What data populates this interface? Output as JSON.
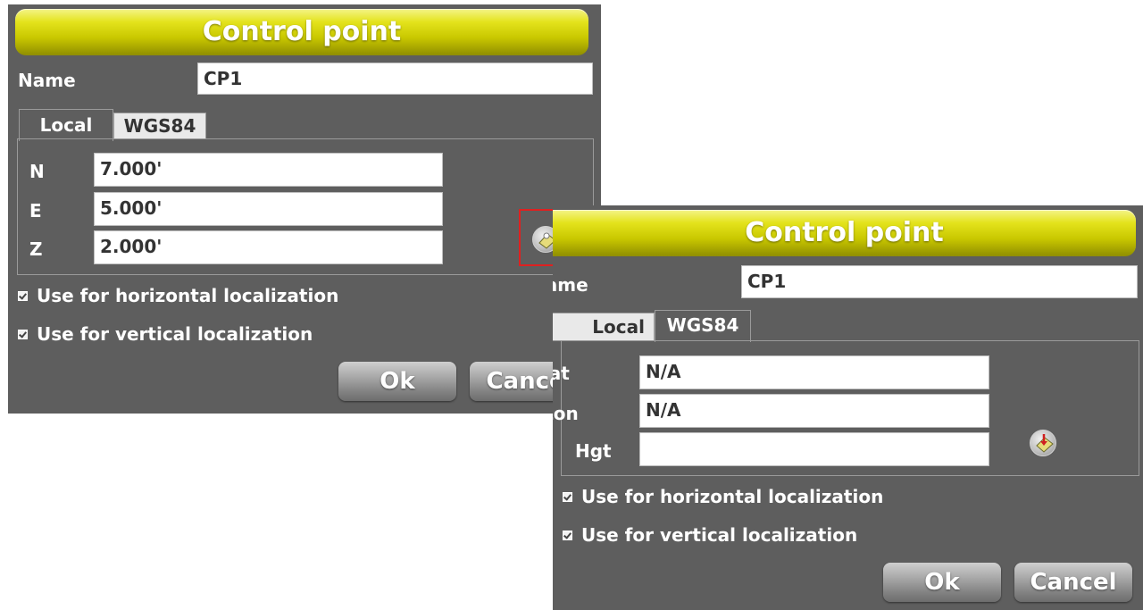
{
  "dialogs": [
    {
      "title": "Control point",
      "name_label": "Name",
      "name_value": "CP1",
      "tabs": [
        {
          "label": "Local",
          "active": true
        },
        {
          "label": "WGS84",
          "active": false
        }
      ],
      "fields": [
        {
          "label": "N",
          "value": "7.000'"
        },
        {
          "label": "E",
          "value": "5.000'"
        },
        {
          "label": "Z",
          "value": "2.000'"
        }
      ],
      "icon": "measure-point-icon",
      "checkboxes": [
        {
          "label": "Use for horizontal localization",
          "checked": true
        },
        {
          "label": "Use for vertical localization",
          "checked": true
        }
      ],
      "ok_label": "Ok",
      "cancel_label": "Cancel"
    },
    {
      "title": "Control point",
      "name_label": "Name",
      "name_value": "CP1",
      "tabs": [
        {
          "label": "Local",
          "active": false
        },
        {
          "label": "WGS84",
          "active": true
        }
      ],
      "fields": [
        {
          "label": "Lat",
          "value": "N/A"
        },
        {
          "label": "Lon",
          "value": "N/A"
        },
        {
          "label": "Hgt",
          "value": ""
        }
      ],
      "icon": "measure-point-icon",
      "checkboxes": [
        {
          "label": "Use for horizontal localization",
          "checked": true
        },
        {
          "label": "Use for vertical localization",
          "checked": true
        }
      ],
      "ok_label": "Ok",
      "cancel_label": "Cancel"
    }
  ],
  "colors": {
    "panel_bg": "#5e5e5e",
    "title_bar": "#d4d300",
    "highlight": "#e02020"
  }
}
